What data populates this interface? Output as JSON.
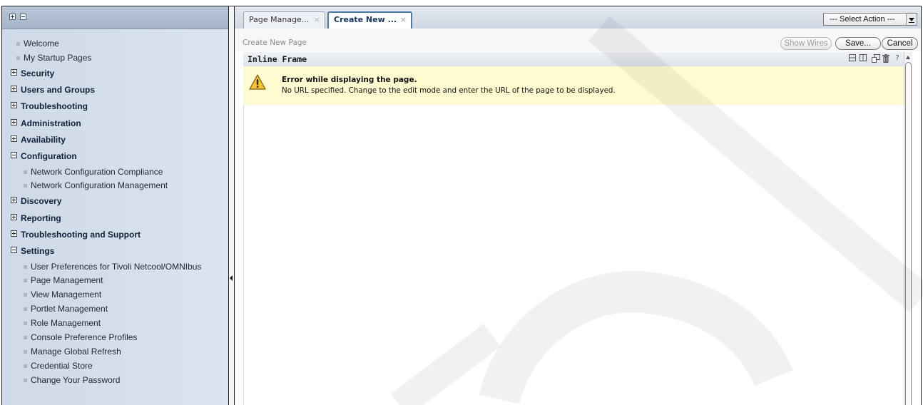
{
  "nav": {
    "items": [
      {
        "kind": "leaf",
        "label": "Welcome"
      },
      {
        "kind": "leaf",
        "label": "My Startup Pages"
      },
      {
        "kind": "cat",
        "label": "Security",
        "expanded": false
      },
      {
        "kind": "cat",
        "label": "Users and Groups",
        "expanded": false
      },
      {
        "kind": "cat",
        "label": "Troubleshooting",
        "expanded": false
      },
      {
        "kind": "cat",
        "label": "Administration",
        "expanded": false
      },
      {
        "kind": "cat",
        "label": "Availability",
        "expanded": false
      },
      {
        "kind": "cat",
        "label": "Configuration",
        "expanded": true
      },
      {
        "kind": "sub",
        "label": "Network Configuration Compliance"
      },
      {
        "kind": "sub",
        "label": "Network Configuration Management"
      },
      {
        "kind": "cat",
        "label": "Discovery",
        "expanded": false
      },
      {
        "kind": "cat",
        "label": "Reporting",
        "expanded": false
      },
      {
        "kind": "cat",
        "label": "Troubleshooting and Support",
        "expanded": false
      },
      {
        "kind": "cat",
        "label": "Settings",
        "expanded": true
      },
      {
        "kind": "sub",
        "label": "User Preferences for Tivoli Netcool/OMNIbus"
      },
      {
        "kind": "sub",
        "label": "Page Management"
      },
      {
        "kind": "sub",
        "label": "View Management"
      },
      {
        "kind": "sub",
        "label": "Portlet Management"
      },
      {
        "kind": "sub",
        "label": "Role Management"
      },
      {
        "kind": "sub",
        "label": "Console Preference Profiles"
      },
      {
        "kind": "sub",
        "label": "Manage Global Refresh"
      },
      {
        "kind": "sub",
        "label": "Credential Store"
      },
      {
        "kind": "sub",
        "label": "Change Your Password"
      }
    ]
  },
  "tabs": [
    {
      "label": "Page Manage...",
      "close": "×",
      "active": false
    },
    {
      "label": "Create New ...",
      "close": "×",
      "active": true
    }
  ],
  "select_action": {
    "value": "--- Select Action ---"
  },
  "toolbar": {
    "breadcrumb": "Create New Page",
    "show_wires": "Show Wires",
    "save": "Save...",
    "cancel": "Cancel"
  },
  "portlet": {
    "title": "Inline Frame",
    "icons": [
      "minimize-icon",
      "maximize-icon",
      "new-window-icon",
      "delete-icon",
      "help-icon"
    ],
    "help_glyph": "?",
    "error_title": "Error while displaying the page.",
    "error_message": "No URL specified. Change to the edit mode and enter the URL of the page to be displayed."
  },
  "colors": {
    "nav_bg": "#dbe4ef",
    "warning_bg": "#fffbd1",
    "active_tab_border": "#4e79a9"
  }
}
